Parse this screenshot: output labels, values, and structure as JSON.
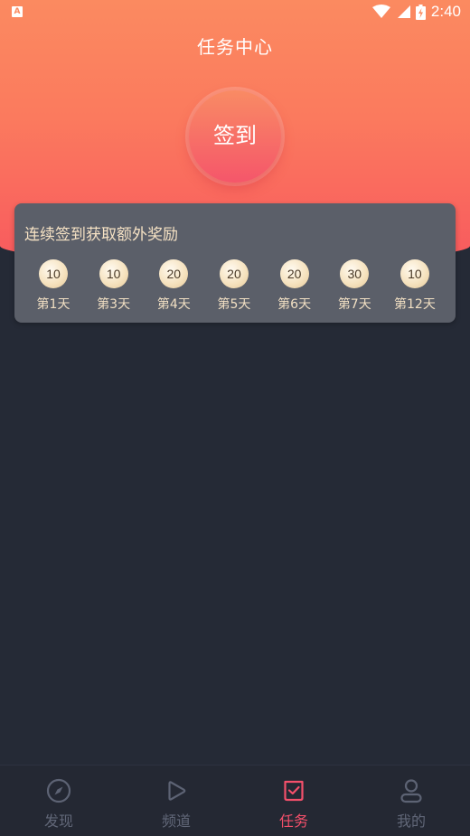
{
  "status_bar": {
    "app_icon": "A",
    "time": "2:40",
    "icons": [
      "wifi-icon",
      "signal-icon",
      "battery-icon"
    ]
  },
  "page": {
    "title": "任务中心"
  },
  "checkin": {
    "button_label": "签到"
  },
  "rewards": {
    "title": "连续签到获取额外奖励",
    "items": [
      {
        "points": "10",
        "day": "第1天"
      },
      {
        "points": "10",
        "day": "第3天"
      },
      {
        "points": "20",
        "day": "第4天"
      },
      {
        "points": "20",
        "day": "第5天"
      },
      {
        "points": "20",
        "day": "第6天"
      },
      {
        "points": "30",
        "day": "第7天"
      },
      {
        "points": "10",
        "day": "第12天"
      }
    ]
  },
  "bottom_nav": {
    "items": [
      {
        "label": "发现",
        "icon": "compass-icon"
      },
      {
        "label": "频道",
        "icon": "play-icon"
      },
      {
        "label": "任务",
        "icon": "task-check-icon",
        "active": true
      },
      {
        "label": "我的",
        "icon": "user-icon"
      }
    ]
  },
  "colors": {
    "accent": "#f4506b",
    "header_top": "#fb8a60",
    "header_bottom": "#f85a5e",
    "background": "#252a36",
    "card": "#5b5f69",
    "gold_text": "#f6e2c4"
  }
}
